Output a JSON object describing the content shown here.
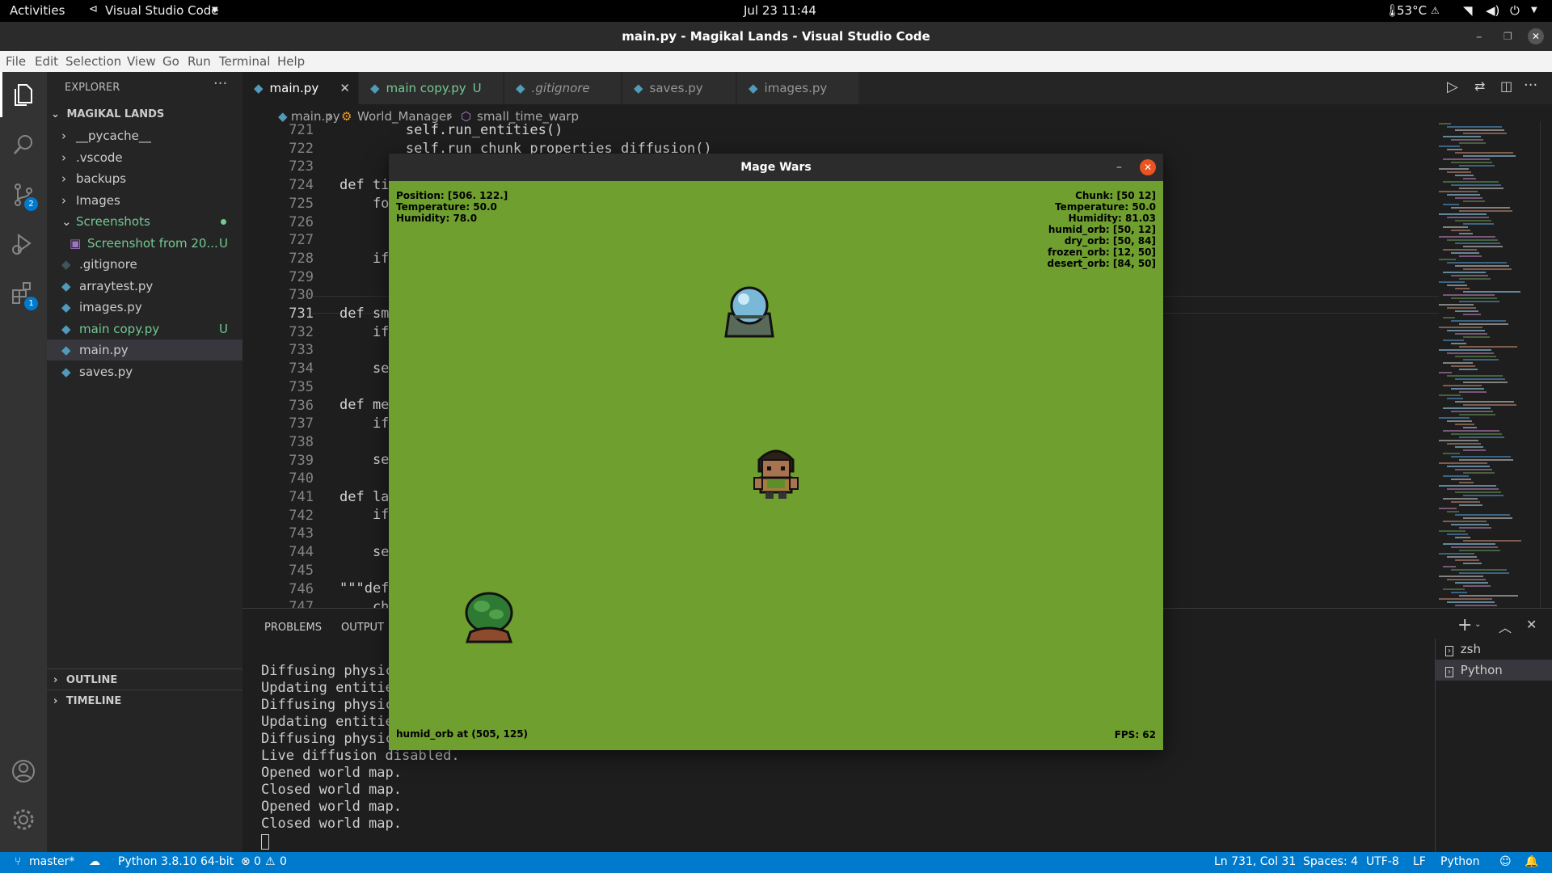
{
  "gnome": {
    "activities": "Activities",
    "app_menu": "Visual Studio Code",
    "clock": "Jul 23  11:44",
    "temperature": "53°C"
  },
  "window": {
    "title": "main.py - Magikal Lands - Visual Studio Code"
  },
  "menu": [
    "File",
    "Edit",
    "Selection",
    "View",
    "Go",
    "Run",
    "Terminal",
    "Help"
  ],
  "activity": {
    "scm_badge": "2",
    "extensions_badge": "1"
  },
  "explorer": {
    "header": "EXPLORER",
    "project": "MAGIKAL LANDS",
    "items": [
      {
        "label": "__pycache__",
        "type": "folder",
        "status": ""
      },
      {
        "label": ".vscode",
        "type": "folder",
        "status": ""
      },
      {
        "label": "backups",
        "type": "folder",
        "status": ""
      },
      {
        "label": "Images",
        "type": "folder",
        "status": ""
      },
      {
        "label": "Screenshots",
        "type": "folder-open",
        "status": "dot"
      },
      {
        "label": "Screenshot from 20...",
        "type": "image",
        "status": "U"
      },
      {
        "label": ".gitignore",
        "type": "file",
        "status": ""
      },
      {
        "label": "arraytest.py",
        "type": "py",
        "status": ""
      },
      {
        "label": "images.py",
        "type": "py",
        "status": ""
      },
      {
        "label": "main copy.py",
        "type": "py",
        "status": "U"
      },
      {
        "label": "main.py",
        "type": "py",
        "status": ""
      },
      {
        "label": "saves.py",
        "type": "py",
        "status": ""
      }
    ],
    "outline": "OUTLINE",
    "timeline": "TIMELINE"
  },
  "tabs": [
    {
      "label": "main.py",
      "status": "",
      "active": true
    },
    {
      "label": "main copy.py",
      "status": "U",
      "active": false
    },
    {
      "label": ".gitignore",
      "status": "",
      "active": false
    },
    {
      "label": "saves.py",
      "status": "",
      "active": false
    },
    {
      "label": "images.py",
      "status": "",
      "active": false
    }
  ],
  "breadcrumb": [
    "main.py",
    "World_Manager",
    "small_time_warp"
  ],
  "editor": {
    "line_numbers": [
      "721",
      "722",
      "723",
      "724",
      "725",
      "726",
      "727",
      "728",
      "729",
      "730",
      "731",
      "732",
      "733",
      "734",
      "735",
      "736",
      "737",
      "738",
      "739",
      "740",
      "741",
      "742",
      "743",
      "744",
      "745",
      "746",
      "747"
    ],
    "current_line": "731",
    "code": [
      "        self.run_entities()",
      "        self.run_chunk_properties_diffusion()",
      "",
      "def ti",
      "    fo",
      "",
      "",
      "    if",
      "",
      "",
      "def sm",
      "    if",
      "",
      "    se",
      "",
      "def me",
      "    if",
      "",
      "    se",
      "",
      "def la",
      "    if",
      "",
      "    se",
      "",
      "\"\"\"def",
      "    ch"
    ]
  },
  "panel": {
    "tabs": [
      "PROBLEMS",
      "OUTPUT"
    ],
    "terminal_lines": [
      "Diffusing physic",
      "Updating entitie",
      "Diffusing physic",
      "Updating entitie",
      "Diffusing physic",
      "Live diffusion disabled.",
      "Opened world map.",
      "Closed world map.",
      "Opened world map.",
      "Closed world map."
    ],
    "terminals": [
      "zsh",
      "Python"
    ]
  },
  "game": {
    "title": "Mage Wars",
    "hud_left": [
      "Position: [506. 122.]",
      "Temperature: 50.0",
      "Humidity: 78.0"
    ],
    "hud_right": [
      "Chunk: [50 12]",
      "Temperature: 50.0",
      "Humidity: 81.03",
      "humid_orb: [50, 12]",
      "dry_orb: [50, 84]",
      "frozen_orb: [12, 50]",
      "desert_orb: [84, 50]"
    ],
    "status_left": "humid_orb at (505, 125)",
    "fps": "FPS: 62",
    "colors": {
      "grass": "#6f9f2f"
    }
  },
  "status": {
    "branch": "master*",
    "python": "Python 3.8.10 64-bit",
    "problems": "0",
    "warnings": "0",
    "position": "Ln 731, Col 31",
    "spaces": "Spaces: 4",
    "encoding": "UTF-8",
    "eol": "LF",
    "language": "Python"
  }
}
